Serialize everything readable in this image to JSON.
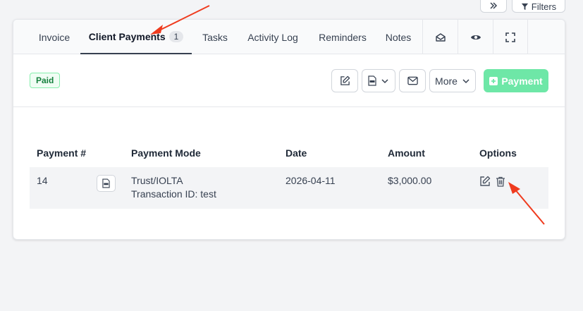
{
  "header": {
    "collapse_icon": "double-chevron-right-icon",
    "filters_label": "Filters",
    "filters_icon": "funnel-icon"
  },
  "tabs": [
    {
      "label": "Invoice",
      "active": false
    },
    {
      "label": "Client Payments",
      "active": true,
      "count": "1"
    },
    {
      "label": "Tasks",
      "active": false
    },
    {
      "label": "Activity Log",
      "active": false
    },
    {
      "label": "Reminders",
      "active": false
    },
    {
      "label": "Notes",
      "active": false
    }
  ],
  "tab_icons": [
    "envelope-open-icon",
    "eye-icon",
    "expand-icon"
  ],
  "status_badge": "Paid",
  "toolbar": {
    "edit_icon": "pencil-square-icon",
    "pdf_icon": "pdf-file-icon",
    "email_icon": "envelope-icon",
    "more_label": "More",
    "payment_label": "Payment",
    "colors": {
      "payment_bg": "#6ee7a7",
      "paid_text": "#15803d"
    }
  },
  "table": {
    "columns": [
      "Payment #",
      "Payment Mode",
      "Date",
      "Amount",
      "Options"
    ],
    "rows": [
      {
        "number": "14",
        "mode": "Trust/IOLTA",
        "transaction": "Transaction ID: test",
        "date": "2026-04-11",
        "amount": "$3,000.00"
      }
    ]
  },
  "annotation_color": "#ef3b1e"
}
